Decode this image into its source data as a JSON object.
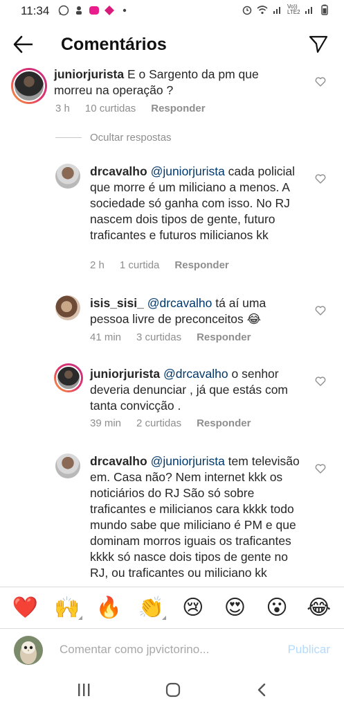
{
  "status": {
    "time": "11:34",
    "carrier": "Vo)) LTE2"
  },
  "header": {
    "title": "Comentários"
  },
  "comments": [
    {
      "username": "juniorjurista",
      "text": "E o Sargento da pm que morreu na operação ?",
      "time": "3 h",
      "likes": "10 curtidas",
      "reply": "Responder"
    },
    {
      "username": "drcavalho",
      "mention": "@juniorjurista",
      "text": " cada policial que morre é um miliciano a menos. A sociedade só ganha com isso. No RJ nascem dois tipos de gente, futuro traficantes e futuros milicianos kk",
      "time": "2 h",
      "likes": "1 curtida",
      "reply": "Responder"
    },
    {
      "username": "isis_sisi_",
      "mention": "@drcavalho",
      "text": " tá aí uma pessoa livre de preconceitos 😂",
      "time": "41 min",
      "likes": "3 curtidas",
      "reply": "Responder"
    },
    {
      "username": "juniorjurista",
      "mention": "@drcavalho",
      "text": " o senhor deveria denunciar , já que estás com tanta convicção .",
      "time": "39 min",
      "likes": "2 curtidas",
      "reply": "Responder"
    },
    {
      "username": "drcavalho",
      "mention": "@juniorjurista",
      "text": " tem televisão em. Casa não? Nem internet kkk os noticiários do RJ São só sobre traficantes e milicianos cara kkkk todo mundo sabe que miliciano é PM e que dominam morros iguais os traficantes kkkk só nasce dois tipos de gente no RJ, ou traficantes ou miliciano kk"
    }
  ],
  "hide_replies": "Ocultar respostas",
  "emojis": [
    "❤️",
    "🙌",
    "🔥",
    "👏",
    "😢",
    "😍",
    "😮",
    "😂"
  ],
  "input": {
    "placeholder": "Comentar como jpvictorino...",
    "publish": "Publicar"
  },
  "colors": {
    "text": "#262626",
    "muted": "#8e8e8e",
    "mention": "#00376b",
    "publish_disabled": "#b3dbff"
  }
}
